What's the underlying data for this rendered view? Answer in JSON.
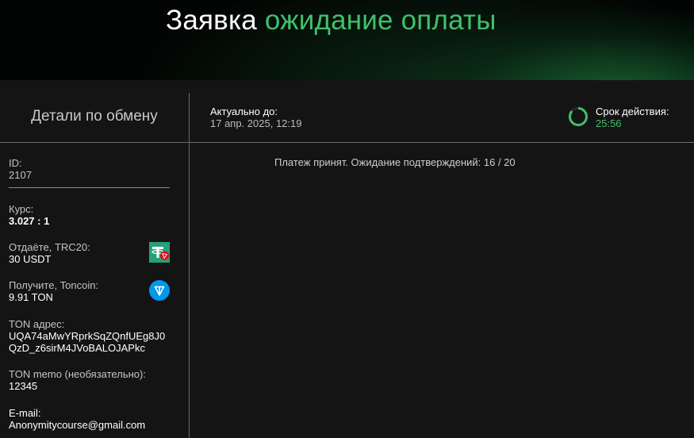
{
  "header": {
    "title_prefix": "Заявка",
    "title_status": "ожидание оплаты"
  },
  "details_title": "Детали по обмену",
  "actual": {
    "label": "Актуально до:",
    "value": "17 апр. 2025, 12:19"
  },
  "timer": {
    "label": "Срок действия:",
    "value": "25:56",
    "remaining_fraction": 0.86,
    "color": "#3fc16b"
  },
  "status_message": "Платеж принят. Ожидание подтверждений: 16 / 20",
  "fields": {
    "id": {
      "label": "ID:",
      "value": "2107"
    },
    "rate": {
      "label": "Курс:",
      "value": "3.027 : 1"
    },
    "give": {
      "label": "Отдаёте, TRC20:",
      "value": "30 USDT",
      "icon": "usdt-trc20-icon"
    },
    "receive": {
      "label": "Получите, Toncoin:",
      "value": "9.91 TON",
      "icon": "toncoin-icon"
    },
    "address": {
      "label": "TON адрес:",
      "value_line1": "UQA74aMwYRprkSqZQnfUEg8J0",
      "value_line2": "QzD_z6sirM4JVoBALOJAPkc"
    },
    "memo": {
      "label": "TON memo (необязательно):",
      "value": "12345"
    },
    "email": {
      "label": "E-mail:",
      "value": "Anonymitycourse@gmail.com"
    }
  },
  "colors": {
    "accent_green": "#3fc16b",
    "background": "#141414",
    "tether_green": "#26a17b",
    "tron_red": "#e50915",
    "ton_blue": "#0098ea"
  }
}
